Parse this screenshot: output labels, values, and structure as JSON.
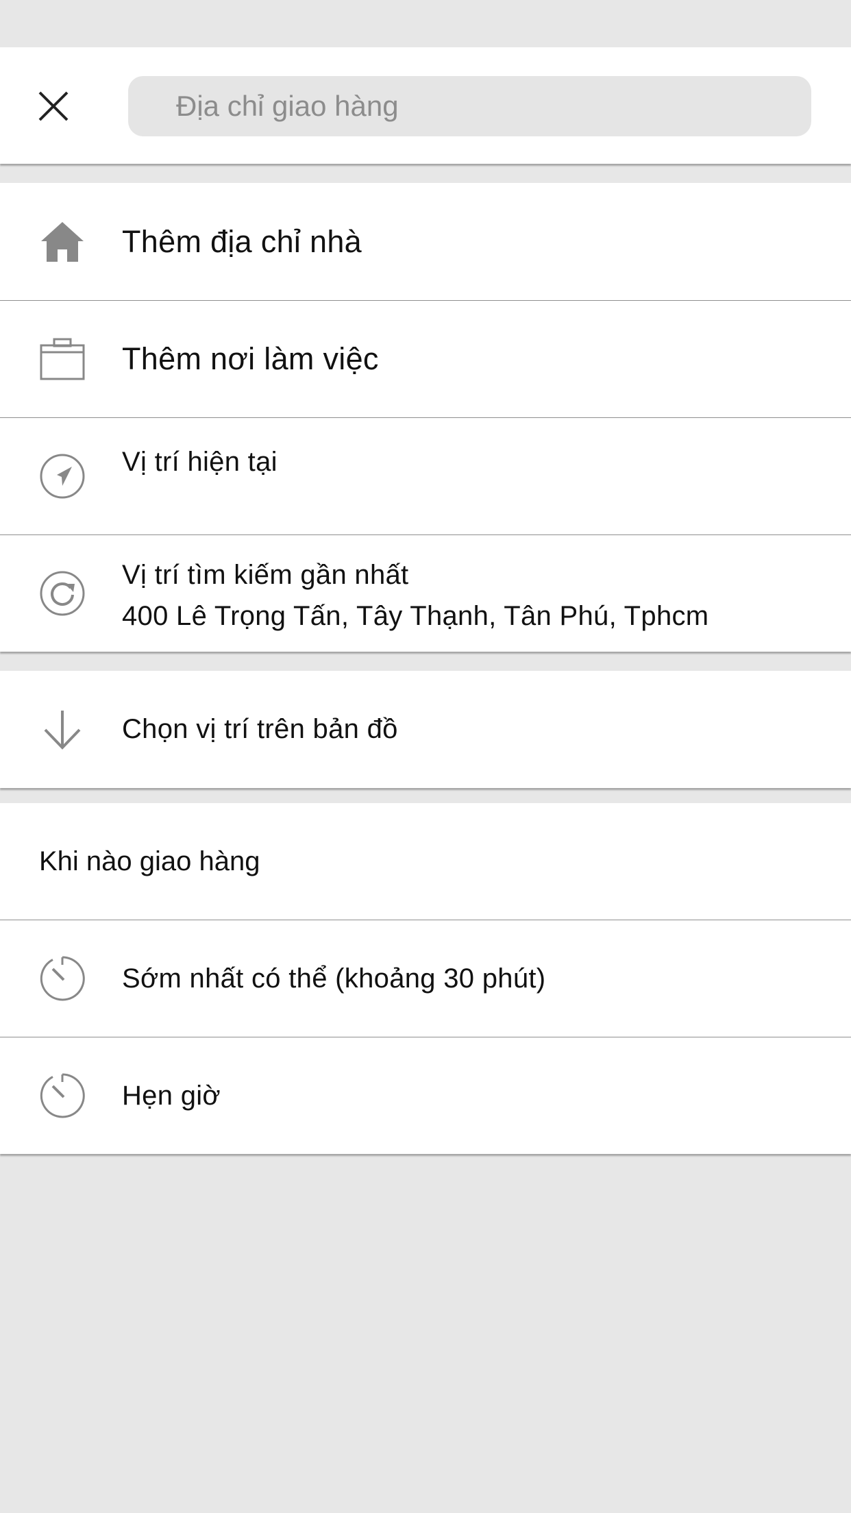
{
  "search": {
    "placeholder": "Địa chỉ giao hàng"
  },
  "addresses": {
    "home_label": "Thêm địa chỉ nhà",
    "work_label": "Thêm nơi làm việc",
    "current_location_label": "Vị trí hiện tại",
    "recent_title": "Vị trí tìm kiếm gần nhất",
    "recent_address": "400 Lê Trọng Tấn, Tây Thạnh, Tân Phú, Tphcm"
  },
  "map": {
    "pick_label": "Chọn vị trí trên bản đồ"
  },
  "delivery_time": {
    "header": "Khi nào giao hàng",
    "asap_label": "Sớm nhất có thể (khoảng 30 phút)",
    "schedule_label": "Hẹn giờ"
  },
  "icons": [
    "close-icon",
    "home-icon",
    "briefcase-icon",
    "navigation-icon",
    "history-icon",
    "arrow-down-icon",
    "timer-icon"
  ],
  "colors": {
    "background": "#e7e7e7",
    "card": "#ffffff",
    "search_field": "#e5e5e5",
    "icon_gray": "#888888",
    "divider": "#8f8f8f"
  }
}
